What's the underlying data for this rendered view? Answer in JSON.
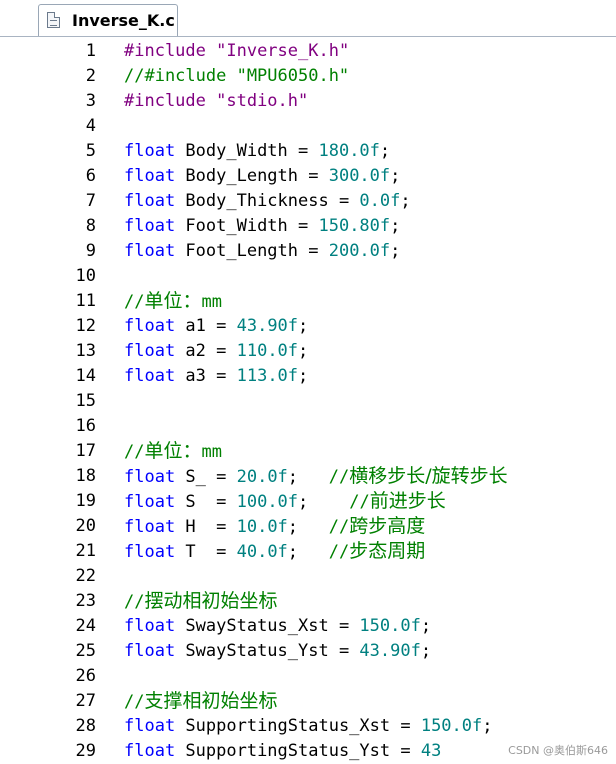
{
  "tab": {
    "label": "Inverse_K.c",
    "icon": "file-icon"
  },
  "colors": {
    "preprocessor": "#800080",
    "comment": "#008000",
    "keyword": "#0000ff",
    "number": "#008080",
    "text": "#000000"
  },
  "lines": [
    {
      "n": "1",
      "tokens": [
        {
          "t": "#include ",
          "c": "pp"
        },
        {
          "t": "\"Inverse_K.h\"",
          "c": "str"
        }
      ]
    },
    {
      "n": "2",
      "tokens": [
        {
          "t": "//#include \"MPU6050.h\"",
          "c": "cmt"
        }
      ]
    },
    {
      "n": "3",
      "tokens": [
        {
          "t": "#include ",
          "c": "pp"
        },
        {
          "t": "\"stdio.h\"",
          "c": "str"
        }
      ]
    },
    {
      "n": "4",
      "tokens": []
    },
    {
      "n": "5",
      "tokens": [
        {
          "t": "float",
          "c": "kw"
        },
        {
          "t": " Body_Width = ",
          "c": "id"
        },
        {
          "t": "180.0f",
          "c": "num"
        },
        {
          "t": ";",
          "c": "op"
        }
      ]
    },
    {
      "n": "6",
      "tokens": [
        {
          "t": "float",
          "c": "kw"
        },
        {
          "t": " Body_Length = ",
          "c": "id"
        },
        {
          "t": "300.0f",
          "c": "num"
        },
        {
          "t": ";",
          "c": "op"
        }
      ]
    },
    {
      "n": "7",
      "tokens": [
        {
          "t": "float",
          "c": "kw"
        },
        {
          "t": " Body_Thickness = ",
          "c": "id"
        },
        {
          "t": "0.0f",
          "c": "num"
        },
        {
          "t": ";",
          "c": "op"
        }
      ]
    },
    {
      "n": "8",
      "tokens": [
        {
          "t": "float",
          "c": "kw"
        },
        {
          "t": " Foot_Width = ",
          "c": "id"
        },
        {
          "t": "150.80f",
          "c": "num"
        },
        {
          "t": ";",
          "c": "op"
        }
      ]
    },
    {
      "n": "9",
      "tokens": [
        {
          "t": "float",
          "c": "kw"
        },
        {
          "t": " Foot_Length = ",
          "c": "id"
        },
        {
          "t": "200.0f",
          "c": "num"
        },
        {
          "t": ";",
          "c": "op"
        }
      ]
    },
    {
      "n": "10",
      "tokens": []
    },
    {
      "n": "11",
      "tokens": [
        {
          "t": "//",
          "c": "cmt"
        },
        {
          "t": "单位：",
          "c": "cmt-cn"
        },
        {
          "t": "mm",
          "c": "cmt"
        }
      ]
    },
    {
      "n": "12",
      "tokens": [
        {
          "t": "float",
          "c": "kw"
        },
        {
          "t": " a1 = ",
          "c": "id"
        },
        {
          "t": "43.90f",
          "c": "num"
        },
        {
          "t": ";",
          "c": "op"
        }
      ]
    },
    {
      "n": "13",
      "tokens": [
        {
          "t": "float",
          "c": "kw"
        },
        {
          "t": " a2 = ",
          "c": "id"
        },
        {
          "t": "110.0f",
          "c": "num"
        },
        {
          "t": ";",
          "c": "op"
        }
      ]
    },
    {
      "n": "14",
      "tokens": [
        {
          "t": "float",
          "c": "kw"
        },
        {
          "t": " a3 = ",
          "c": "id"
        },
        {
          "t": "113.0f",
          "c": "num"
        },
        {
          "t": ";",
          "c": "op"
        }
      ]
    },
    {
      "n": "15",
      "tokens": []
    },
    {
      "n": "16",
      "tokens": []
    },
    {
      "n": "17",
      "tokens": [
        {
          "t": "//",
          "c": "cmt"
        },
        {
          "t": "单位：",
          "c": "cmt-cn"
        },
        {
          "t": "mm",
          "c": "cmt"
        }
      ]
    },
    {
      "n": "18",
      "tokens": [
        {
          "t": "float",
          "c": "kw"
        },
        {
          "t": " S_ = ",
          "c": "id"
        },
        {
          "t": "20.0f",
          "c": "num"
        },
        {
          "t": ";   ",
          "c": "op"
        },
        {
          "t": "//",
          "c": "cmt"
        },
        {
          "t": "横移步长/旋转步长",
          "c": "cmt-cn"
        }
      ]
    },
    {
      "n": "19",
      "tokens": [
        {
          "t": "float",
          "c": "kw"
        },
        {
          "t": " S  = ",
          "c": "id"
        },
        {
          "t": "100.0f",
          "c": "num"
        },
        {
          "t": ";    ",
          "c": "op"
        },
        {
          "t": "//",
          "c": "cmt"
        },
        {
          "t": "前进步长",
          "c": "cmt-cn"
        }
      ]
    },
    {
      "n": "20",
      "tokens": [
        {
          "t": "float",
          "c": "kw"
        },
        {
          "t": " H  = ",
          "c": "id"
        },
        {
          "t": "10.0f",
          "c": "num"
        },
        {
          "t": ";   ",
          "c": "op"
        },
        {
          "t": "//",
          "c": "cmt"
        },
        {
          "t": "跨步高度",
          "c": "cmt-cn"
        }
      ]
    },
    {
      "n": "21",
      "tokens": [
        {
          "t": "float",
          "c": "kw"
        },
        {
          "t": " T  = ",
          "c": "id"
        },
        {
          "t": "40.0f",
          "c": "num"
        },
        {
          "t": ";   ",
          "c": "op"
        },
        {
          "t": "//",
          "c": "cmt"
        },
        {
          "t": "步态周期",
          "c": "cmt-cn"
        }
      ]
    },
    {
      "n": "22",
      "tokens": []
    },
    {
      "n": "23",
      "tokens": [
        {
          "t": "//",
          "c": "cmt"
        },
        {
          "t": "摆动相初始坐标",
          "c": "cmt-cn"
        }
      ]
    },
    {
      "n": "24",
      "tokens": [
        {
          "t": "float",
          "c": "kw"
        },
        {
          "t": " SwayStatus_Xst = ",
          "c": "id"
        },
        {
          "t": "150.0f",
          "c": "num"
        },
        {
          "t": ";",
          "c": "op"
        }
      ]
    },
    {
      "n": "25",
      "tokens": [
        {
          "t": "float",
          "c": "kw"
        },
        {
          "t": " SwayStatus_Yst = ",
          "c": "id"
        },
        {
          "t": "43.90f",
          "c": "num"
        },
        {
          "t": ";",
          "c": "op"
        }
      ]
    },
    {
      "n": "26",
      "tokens": []
    },
    {
      "n": "27",
      "tokens": [
        {
          "t": "//",
          "c": "cmt"
        },
        {
          "t": "支撑相初始坐标",
          "c": "cmt-cn"
        }
      ]
    },
    {
      "n": "28",
      "tokens": [
        {
          "t": "float",
          "c": "kw"
        },
        {
          "t": " SupportingStatus_Xst = ",
          "c": "id"
        },
        {
          "t": "150.0f",
          "c": "num"
        },
        {
          "t": ";",
          "c": "op"
        }
      ]
    },
    {
      "n": "29",
      "tokens": [
        {
          "t": "float",
          "c": "kw"
        },
        {
          "t": " SupportingStatus_Yst = ",
          "c": "id"
        },
        {
          "t": "43",
          "c": "num"
        }
      ]
    }
  ],
  "watermark": "CSDN @奥伯斯646"
}
